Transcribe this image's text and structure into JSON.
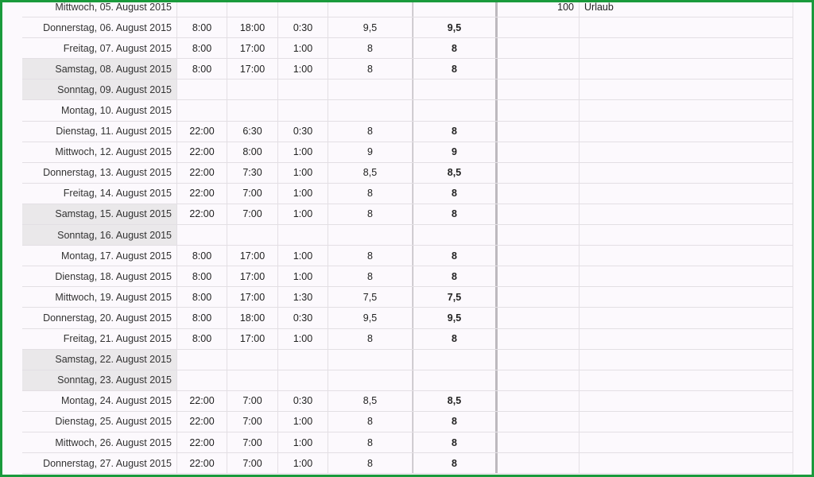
{
  "rows": [
    {
      "date": "Mittwoch, 05. August 2015",
      "start": "",
      "end": "",
      "pause": "",
      "hours": "",
      "total": "",
      "extra": "100",
      "note": "Urlaub",
      "weekend": false
    },
    {
      "date": "Donnerstag, 06. August 2015",
      "start": "8:00",
      "end": "18:00",
      "pause": "0:30",
      "hours": "9,5",
      "total": "9,5",
      "extra": "",
      "note": "",
      "weekend": false
    },
    {
      "date": "Freitag, 07. August 2015",
      "start": "8:00",
      "end": "17:00",
      "pause": "1:00",
      "hours": "8",
      "total": "8",
      "extra": "",
      "note": "",
      "weekend": false
    },
    {
      "date": "Samstag, 08. August 2015",
      "start": "8:00",
      "end": "17:00",
      "pause": "1:00",
      "hours": "8",
      "total": "8",
      "extra": "",
      "note": "",
      "weekend": true
    },
    {
      "date": "Sonntag, 09. August 2015",
      "start": "",
      "end": "",
      "pause": "",
      "hours": "",
      "total": "",
      "extra": "",
      "note": "",
      "weekend": true
    },
    {
      "date": "Montag, 10. August 2015",
      "start": "",
      "end": "",
      "pause": "",
      "hours": "",
      "total": "",
      "extra": "",
      "note": "",
      "weekend": false
    },
    {
      "date": "Dienstag, 11. August 2015",
      "start": "22:00",
      "end": "6:30",
      "pause": "0:30",
      "hours": "8",
      "total": "8",
      "extra": "",
      "note": "",
      "weekend": false
    },
    {
      "date": "Mittwoch, 12. August 2015",
      "start": "22:00",
      "end": "8:00",
      "pause": "1:00",
      "hours": "9",
      "total": "9",
      "extra": "",
      "note": "",
      "weekend": false
    },
    {
      "date": "Donnerstag, 13. August 2015",
      "start": "22:00",
      "end": "7:30",
      "pause": "1:00",
      "hours": "8,5",
      "total": "8,5",
      "extra": "",
      "note": "",
      "weekend": false
    },
    {
      "date": "Freitag, 14. August 2015",
      "start": "22:00",
      "end": "7:00",
      "pause": "1:00",
      "hours": "8",
      "total": "8",
      "extra": "",
      "note": "",
      "weekend": false
    },
    {
      "date": "Samstag, 15. August 2015",
      "start": "22:00",
      "end": "7:00",
      "pause": "1:00",
      "hours": "8",
      "total": "8",
      "extra": "",
      "note": "",
      "weekend": true
    },
    {
      "date": "Sonntag, 16. August 2015",
      "start": "",
      "end": "",
      "pause": "",
      "hours": "",
      "total": "",
      "extra": "",
      "note": "",
      "weekend": true
    },
    {
      "date": "Montag, 17. August 2015",
      "start": "8:00",
      "end": "17:00",
      "pause": "1:00",
      "hours": "8",
      "total": "8",
      "extra": "",
      "note": "",
      "weekend": false
    },
    {
      "date": "Dienstag, 18. August 2015",
      "start": "8:00",
      "end": "17:00",
      "pause": "1:00",
      "hours": "8",
      "total": "8",
      "extra": "",
      "note": "",
      "weekend": false
    },
    {
      "date": "Mittwoch, 19. August 2015",
      "start": "8:00",
      "end": "17:00",
      "pause": "1:30",
      "hours": "7,5",
      "total": "7,5",
      "extra": "",
      "note": "",
      "weekend": false
    },
    {
      "date": "Donnerstag, 20. August 2015",
      "start": "8:00",
      "end": "18:00",
      "pause": "0:30",
      "hours": "9,5",
      "total": "9,5",
      "extra": "",
      "note": "",
      "weekend": false
    },
    {
      "date": "Freitag, 21. August 2015",
      "start": "8:00",
      "end": "17:00",
      "pause": "1:00",
      "hours": "8",
      "total": "8",
      "extra": "",
      "note": "",
      "weekend": false
    },
    {
      "date": "Samstag, 22. August 2015",
      "start": "",
      "end": "",
      "pause": "",
      "hours": "",
      "total": "",
      "extra": "",
      "note": "",
      "weekend": true
    },
    {
      "date": "Sonntag, 23. August 2015",
      "start": "",
      "end": "",
      "pause": "",
      "hours": "",
      "total": "",
      "extra": "",
      "note": "",
      "weekend": true
    },
    {
      "date": "Montag, 24. August 2015",
      "start": "22:00",
      "end": "7:00",
      "pause": "0:30",
      "hours": "8,5",
      "total": "8,5",
      "extra": "",
      "note": "",
      "weekend": false
    },
    {
      "date": "Dienstag, 25. August 2015",
      "start": "22:00",
      "end": "7:00",
      "pause": "1:00",
      "hours": "8",
      "total": "8",
      "extra": "",
      "note": "",
      "weekend": false
    },
    {
      "date": "Mittwoch, 26. August 2015",
      "start": "22:00",
      "end": "7:00",
      "pause": "1:00",
      "hours": "8",
      "total": "8",
      "extra": "",
      "note": "",
      "weekend": false
    },
    {
      "date": "Donnerstag, 27. August 2015",
      "start": "22:00",
      "end": "7:00",
      "pause": "1:00",
      "hours": "8",
      "total": "8",
      "extra": "",
      "note": "",
      "weekend": false
    }
  ]
}
